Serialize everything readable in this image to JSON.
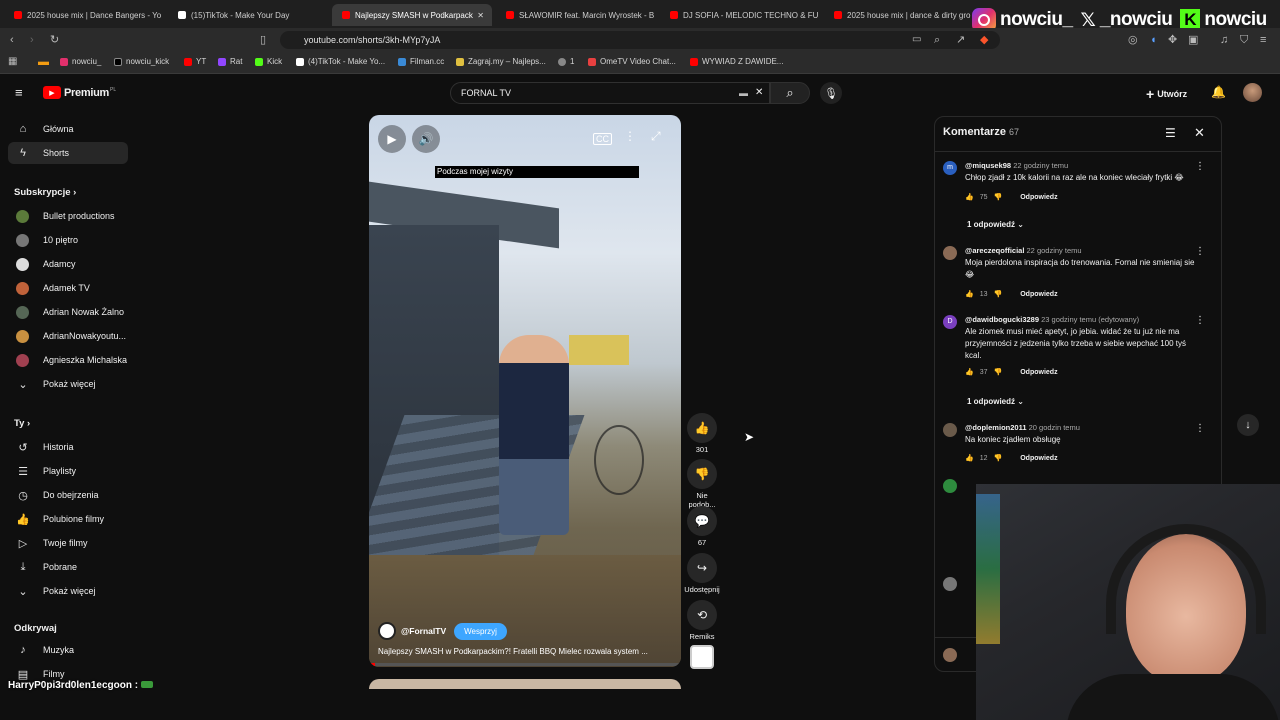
{
  "tabs": [
    {
      "label": "2025 house mix | Dance Bangers - Yo",
      "color": "#ff0000"
    },
    {
      "label": "(15)TikTok - Make Your Day",
      "color": "#ffffff"
    },
    {
      "label": "Najlepszy SMASH w Podkarpack",
      "color": "#ff0000"
    },
    {
      "label": "SŁAWOMIR feat. Marcin Wyrostek - B",
      "color": "#ff0000"
    },
    {
      "label": "DJ SOFIA - MELODIC TECHNO & FU",
      "color": "#ff0000"
    },
    {
      "label": "2025 house mix | dance & dirty gro",
      "color": "#ff0000"
    }
  ],
  "overlay_handles": {
    "instagram": "nowciu_",
    "x": "_nowciu",
    "kick": "nowciu"
  },
  "address": {
    "url": "youtube.com/shorts/3kh-MYp7yJA"
  },
  "bookmarks": [
    "nowciu_",
    "nowciu_kick",
    "YT",
    "Rat",
    "Kick",
    "(4)TikTok - Make Yo...",
    "Filman.cc",
    "Zagraj.my – Najleps...",
    "1",
    "OmeTV Video Chat...",
    "WYWIAD Z DAWIDE..."
  ],
  "header": {
    "logo": "Premium",
    "logo_sup": "PL",
    "search_value": "FORNAL TV",
    "create_label": "Utwórz"
  },
  "sidebar": {
    "main": [
      {
        "label": "Główna",
        "icon": "home-icon"
      },
      {
        "label": "Shorts",
        "icon": "shorts-icon"
      }
    ],
    "subs_title": "Subskrypcje",
    "subs": [
      {
        "label": "Bullet productions",
        "color": "#5b7a3a"
      },
      {
        "label": "10 piętro",
        "color": "#777777"
      },
      {
        "label": "Adamcy",
        "color": "#dddddd"
      },
      {
        "label": "Adamek TV",
        "color": "#c0623a"
      },
      {
        "label": "Adrian Nowak Żalno",
        "color": "#556655"
      },
      {
        "label": "AdrianNowakyoutu...",
        "color": "#c89040"
      },
      {
        "label": "Agnieszka Michalska",
        "color": "#a04050"
      }
    ],
    "show_more": "Pokaż więcej",
    "you_title": "Ty",
    "you": [
      {
        "label": "Historia",
        "icon": "history-icon"
      },
      {
        "label": "Playlisty",
        "icon": "playlist-icon"
      },
      {
        "label": "Do obejrzenia",
        "icon": "watch-later-icon"
      },
      {
        "label": "Polubione filmy",
        "icon": "like-icon"
      },
      {
        "label": "Twoje filmy",
        "icon": "video-icon"
      },
      {
        "label": "Pobrane",
        "icon": "download-icon"
      }
    ],
    "show_more2": "Pokaż więcej",
    "explore_title": "Odkrywaj",
    "explore": [
      {
        "label": "Muzyka",
        "icon": "music-icon"
      },
      {
        "label": "Filmy",
        "icon": "film-icon"
      }
    ]
  },
  "video": {
    "caption": "Podczas mojej wizyty",
    "channel": "@FornalTV",
    "support_label": "Wesprzyj",
    "title": "Najlepszy SMASH w Podkarpackim?! Fratelli BBQ Mielec rozwala system ..."
  },
  "actions": {
    "like_count": "301",
    "dislike_label": "Nie podob...",
    "comment_count": "67",
    "share_label": "Udostępnij",
    "remix_label": "Remiks"
  },
  "comments": {
    "title": "Komentarze",
    "count": "67",
    "items": [
      {
        "author": "@miqusek98",
        "time": "22 godziny temu",
        "text": "Chłop zjadł z 10k kalorii na raz ale na koniec wleciały frytki 😂",
        "likes": "75",
        "avatar": "m",
        "avatar_color": "#2a5fbf",
        "replies": "1 odpowiedź"
      },
      {
        "author": "@areczeqofficial",
        "time": "22 godziny temu",
        "text": "Moja pierdolona inspiracja do trenowania. Fornal nie smieniaj sie 😂",
        "likes": "13",
        "avatar": "",
        "avatar_color": "#8a6a55",
        "replies": ""
      },
      {
        "author": "@dawidbogucki3289",
        "time": "23 godziny temu (edytowany)",
        "text": "Ale ziomek musi mieć apetyt, jo jebia. widać że tu już nie ma przyjemności z jedzenia tylko trzeba w siebie wepchać 100 tyś kcal.",
        "likes": "37",
        "avatar": "D",
        "avatar_color": "#7a3fbf",
        "replies": "1 odpowiedź"
      },
      {
        "author": "@doplemion2011",
        "time": "20 godzin temu",
        "text": "Na koniec zjadłem obsługę",
        "likes": "12",
        "avatar": "",
        "avatar_color": "#6a5a4a",
        "replies": ""
      }
    ],
    "reply_label": "Odpowiedz"
  },
  "chat": {
    "user": "HarryP0pi3rd0len1ecgoon",
    "suffix": ":"
  }
}
